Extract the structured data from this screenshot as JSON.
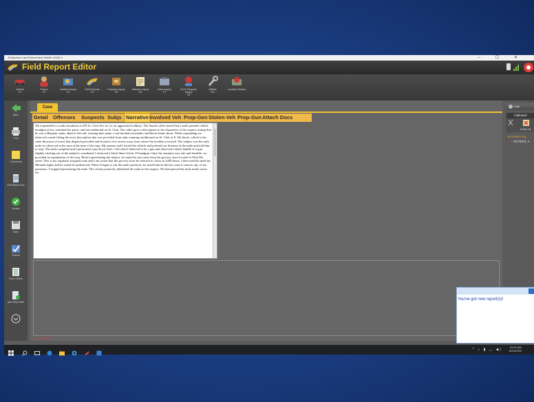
{
  "window": {
    "title": "Enterprise Law Enforcement Mobile v2016.4",
    "controls": "– ☐ ✕"
  },
  "app": {
    "title": "Field Report Editor",
    "brand_color": "#f3c93c"
  },
  "toolbar": [
    {
      "label": "Vehicle",
      "key": "F1",
      "icon": "vehicle-icon"
    },
    {
      "label": "Person",
      "key": "F2",
      "icon": "person-icon"
    },
    {
      "label": "Incident Inquiry",
      "key": "F3",
      "icon": "incident-icon"
    },
    {
      "label": "Field Reports",
      "key": "F4",
      "icon": "field-reports-icon"
    },
    {
      "label": "Property Inquiry",
      "key": "F5",
      "icon": "property-icon"
    },
    {
      "label": "Warrant Inquiry",
      "key": "F6",
      "icon": "warrant-icon"
    },
    {
      "label": "Case Inquiry",
      "key": "F7",
      "icon": "case-icon"
    },
    {
      "label": "NCIC Request Inquiry",
      "key": "F8",
      "icon": "ncic-icon"
    },
    {
      "label": "Utilities",
      "key": "F12",
      "icon": "utilities-icon"
    },
    {
      "label": "Location History",
      "key": "",
      "icon": "location-icon"
    }
  ],
  "sidebar": [
    {
      "label": "Back",
      "icon": "back-arrow-icon"
    },
    {
      "label": "Print",
      "icon": "printer-icon"
    },
    {
      "label": "Comments",
      "icon": "comments-icon"
    },
    {
      "label": "Edit Report Info",
      "icon": "edit-report-icon"
    },
    {
      "label": "Accept",
      "icon": "accept-check-icon"
    },
    {
      "label": "Save",
      "icon": "save-icon"
    },
    {
      "label": "Submit",
      "icon": "submit-check-icon"
    },
    {
      "label": "Error Check",
      "icon": "error-check-icon"
    },
    {
      "label": "Add Story Note",
      "icon": "add-note-icon"
    },
    {
      "label": "",
      "icon": "scroll-down-icon"
    }
  ],
  "case_tab": "Case",
  "tabs": [
    "Detail",
    "Offenses",
    "Suspects",
    "Subjs",
    "Narrative",
    "Involved Veh",
    "Prop-Gen",
    "Stolen-Veh",
    "Prop-Gun",
    "Attach Docs"
  ],
  "active_tab": "Narrative",
  "narrative": "We responded to a radio broadcast at 205 St. Clair Ave in c/w an aggravated robbery. The female caller stated that a male pointed a black handgun at her, snatched her purse, and ran eastbound on St. Clair. The caller gave a description to the dispatcher of the suspect stating that he was a Hispanic male, about 6 feet tall, wearing blue jeans, a red hooded sweatshirt, and black tennis shoes. While responding we observed a male fitting the exact description that was provided from radio running northbound on St. Clair at E. 6th Street, which is the same direction of travel that dispatch provided and located a few streets away from where the incident occurred. The subject was the only male we observed in the area at the time of the stop. My partner and I exited the vehicle and pointed our firearms at the male and told him to stop. The male complied and I performed a pat down frisk. I felt what I believed to be a gun and observed a black handle of a gun slightly sticking out of the subject's waistband. I retrieved a black 9mm Glock 19 handgun. Once the situation was safe and feasible, we provided an explanation of the stop. Before questioning the subject, he stated he just came from the grocery store located at West 9th street. This is my regularly assigned zone and I am aware that the grocery store he referred to closes at 2200 hours. I then read the male his Miranda rights and he stated he understood. When I began to ask the male questions, he stated that he did not want to answer any of my questions. I stopped questioning the male. The victim positively identified the male as the suspect. We then placed the male under arrest for",
  "status": "Not Saved",
  "right_panel": {
    "hide": "Hide",
    "clipboard": "Clipboard",
    "delete": "Delete All",
    "tree_root": "Person Inq",
    "tree_item": "OCTEST, A"
  },
  "notification": "You've got new report(s)!",
  "taskbar": {
    "time": "10:01 AM",
    "date": "6/23/2020"
  }
}
